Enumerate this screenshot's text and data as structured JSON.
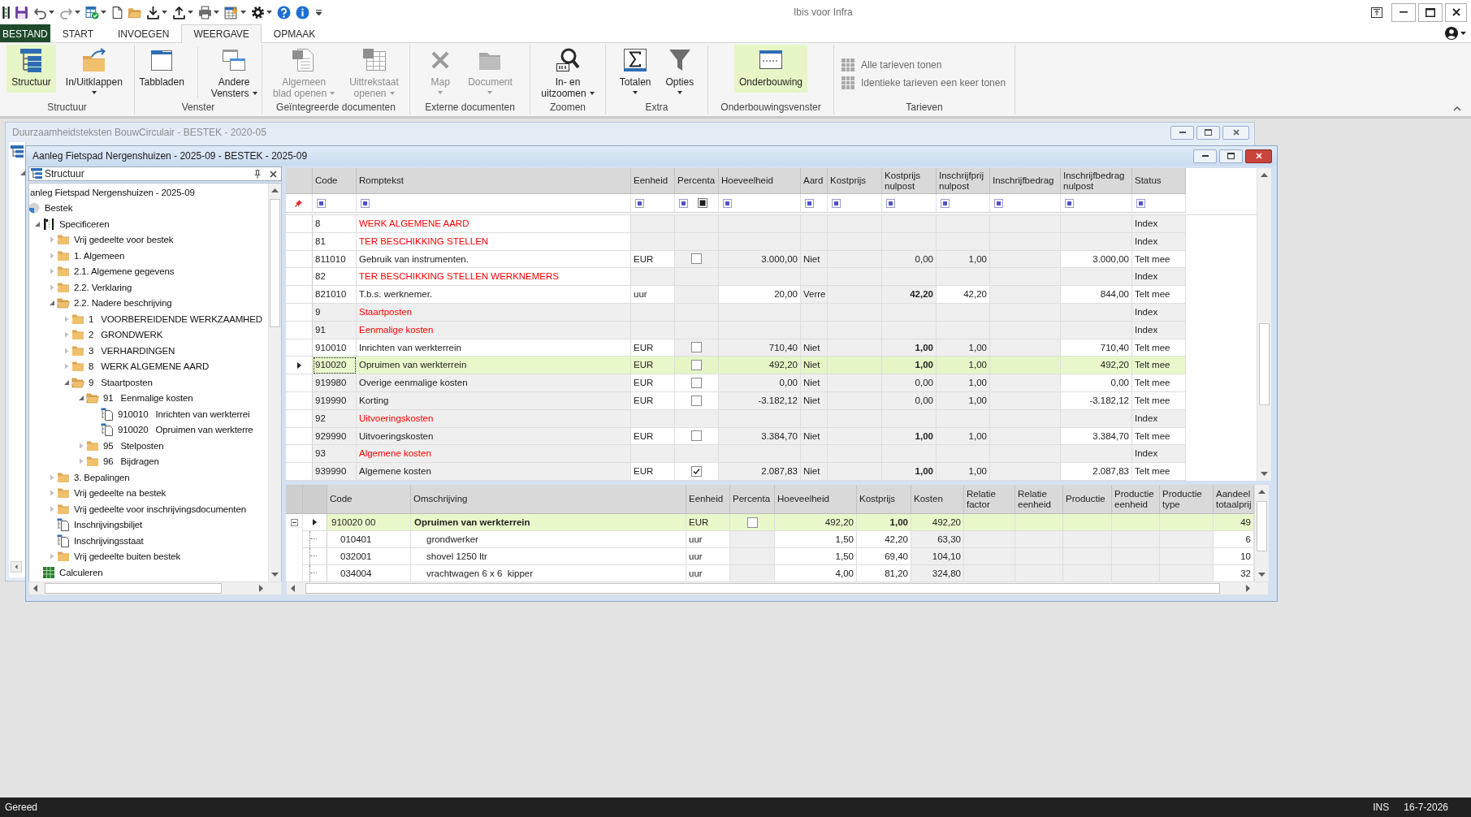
{
  "app": {
    "title": "Ibis voor Infra"
  },
  "ribbon": {
    "tabs": [
      {
        "label": "BESTAND",
        "kind": "file",
        "selected": false
      },
      {
        "label": "START",
        "kind": "tab",
        "selected": false
      },
      {
        "label": "INVOEGEN",
        "kind": "tab",
        "selected": false
      },
      {
        "label": "WEERGAVE",
        "kind": "tab",
        "selected": true
      },
      {
        "label": "OPMAAK",
        "kind": "tab",
        "selected": false
      }
    ],
    "groups": [
      {
        "label": "Structuur",
        "kind": "large",
        "buttons": [
          {
            "lines": [
              "Structuur"
            ],
            "dropdown": false,
            "selected": true,
            "disabled": false
          },
          {
            "lines": [
              "In/Uitklappen"
            ],
            "dropdown": true,
            "selected": false,
            "disabled": false
          }
        ]
      },
      {
        "label": "Venster",
        "kind": "large",
        "buttons": [
          {
            "lines": [
              "Tabbladen"
            ],
            "dropdown": false,
            "selected": false,
            "disabled": false
          },
          {
            "lines": [
              "Andere",
              "Vensters"
            ],
            "dropdown": true,
            "selected": false,
            "disabled": false,
            "divider": true
          }
        ]
      },
      {
        "label": "Geïntegreerde documenten",
        "kind": "large",
        "buttons": [
          {
            "lines": [
              "Algemeen",
              "blad openen"
            ],
            "dropdown": true,
            "selected": false,
            "disabled": true
          },
          {
            "lines": [
              "Uittrekstaat",
              "openen"
            ],
            "dropdown": true,
            "selected": false,
            "disabled": true
          }
        ]
      },
      {
        "label": "Externe documenten",
        "kind": "large",
        "buttons": [
          {
            "lines": [
              "Map"
            ],
            "dropdown": true,
            "selected": false,
            "disabled": true
          },
          {
            "lines": [
              "Document"
            ],
            "dropdown": true,
            "selected": false,
            "disabled": true
          }
        ]
      },
      {
        "label": "Zoomen",
        "kind": "large",
        "buttons": [
          {
            "lines": [
              "In- en",
              "uitzoomen"
            ],
            "dropdown": true,
            "selected": false,
            "disabled": false
          }
        ]
      },
      {
        "label": "Extra",
        "kind": "large",
        "buttons": [
          {
            "lines": [
              "Totalen"
            ],
            "dropdown": true,
            "selected": false,
            "disabled": false
          },
          {
            "lines": [
              "Opties"
            ],
            "dropdown": true,
            "selected": false,
            "disabled": false
          }
        ]
      },
      {
        "label": "Onderbouwingsvenster",
        "kind": "large",
        "buttons": [
          {
            "lines": [
              "Onderbouwing"
            ],
            "dropdown": false,
            "selected": true,
            "disabled": false
          }
        ]
      },
      {
        "label": "Tarieven",
        "kind": "small",
        "buttons": [
          {
            "lines": [
              "Alle tarieven tonen"
            ],
            "dropdown": false,
            "selected": false,
            "disabled": true
          },
          {
            "lines": [
              "Identieke tarieven een keer tonen"
            ],
            "dropdown": false,
            "selected": false,
            "disabled": true
          }
        ]
      }
    ]
  },
  "background_window": {
    "title": "Duurzaamheidsteksten BouwCirculair - BESTEK - 2020-05",
    "active": false,
    "structure_panel": {
      "tree": [
        {
          "expanded": true
        }
      ]
    }
  },
  "document_window": {
    "title": "Aanleg Fietspad Nergenshuizen - 2025-09 - BESTEK - 2025-09",
    "active": true,
    "structure_panel": {
      "title": "Structuur",
      "tree": [
        {
          "label": "anleg Fietspad Nergenshuizen - 2025-09",
          "children": [
            {
              "label": "Bestek",
              "kind": "section",
              "children": [
                {
                  "label": "Specificeren",
                  "kind": "phase",
                  "expanded": true,
                  "children": [
                    {
                      "label": "Vrij gedeelte voor bestek",
                      "kind": "folder",
                      "expanded": false
                    },
                    {
                      "label": "1. Algemeen",
                      "kind": "folder",
                      "expanded": false
                    },
                    {
                      "label": "2.1. Algemene gegevens",
                      "kind": "folder",
                      "expanded": false
                    },
                    {
                      "label": "2.2. Verklaring",
                      "kind": "folder",
                      "expanded": false
                    },
                    {
                      "label": "2.2. Nadere beschrijving",
                      "kind": "folder",
                      "expanded": true,
                      "children": [
                        {
                          "code": "1",
                          "label": "VOORBEREIDENDE WERKZAAMHED",
                          "kind": "folder",
                          "expanded": false
                        },
                        {
                          "code": "2",
                          "label": "GRONDWERK",
                          "kind": "folder",
                          "expanded": false
                        },
                        {
                          "code": "3",
                          "label": "VERHARDINGEN",
                          "kind": "folder",
                          "expanded": false
                        },
                        {
                          "code": "8",
                          "label": "WERK ALGEMENE AARD",
                          "kind": "folder",
                          "expanded": false
                        },
                        {
                          "code": "9",
                          "label": "Staartposten",
                          "kind": "folder",
                          "expanded": true,
                          "children": [
                            {
                              "code": "91",
                              "label": "Eenmalige kosten",
                              "kind": "folder",
                              "expanded": true,
                              "children": [
                                {
                                  "code": "910010",
                                  "label": "Inrichten van werkterrei",
                                  "kind": "entry"
                                },
                                {
                                  "code": "910020",
                                  "label": "Opruimen van werkterre",
                                  "kind": "entry"
                                }
                              ]
                            },
                            {
                              "code": "95",
                              "label": "Stelposten",
                              "kind": "folder",
                              "expanded": false
                            },
                            {
                              "code": "96",
                              "label": "Bijdragen",
                              "kind": "folder",
                              "expanded": false
                            }
                          ]
                        }
                      ]
                    },
                    {
                      "label": "3. Bepalingen",
                      "kind": "folder",
                      "expanded": false
                    },
                    {
                      "label": "Vrij gedeelte na bestek",
                      "kind": "folder",
                      "expanded": false
                    },
                    {
                      "label": "Vrij gedeelte voor inschrijvingsdocumenten",
                      "kind": "folder",
                      "expanded": false
                    },
                    {
                      "label": "Inschrijvingsbiljet",
                      "kind": "document"
                    },
                    {
                      "label": "Inschrijvingsstaat",
                      "kind": "document"
                    },
                    {
                      "label": "Vrij gedeelte buiten bestek",
                      "kind": "folder",
                      "expanded": false
                    }
                  ]
                },
                {
                  "label": "Calculeren",
                  "kind": "calculation"
                }
              ]
            }
          ]
        }
      ]
    },
    "main_grid": {
      "columns": [
        {
          "label": "Code",
          "kind": "text"
        },
        {
          "label": "Romptekst",
          "kind": "text"
        },
        {
          "label": "Eenheid",
          "kind": "text"
        },
        {
          "label": "Percenta",
          "kind": "check",
          "filter_indeterminate": true
        },
        {
          "label": "Hoeveelheid",
          "kind": "text"
        },
        {
          "label": "Aard",
          "kind": "text"
        },
        {
          "label": "Kostprijs",
          "kind": "text"
        },
        {
          "label": "Kostprijs nulpost",
          "kind": "text"
        },
        {
          "label": "Inschrijfprij nulpost",
          "kind": "text"
        },
        {
          "label": "Inschrijfbedrag",
          "kind": "text"
        },
        {
          "label": "Inschrijfbedrag nulpost",
          "kind": "text"
        },
        {
          "label": "Status",
          "kind": "text"
        }
      ],
      "rows": [
        {
          "kind": "heading",
          "selected": false,
          "shaded": false,
          "code": "8",
          "romptekst": "WERK ALGEMENE AARD",
          "status": "Index"
        },
        {
          "kind": "heading",
          "selected": false,
          "shaded": false,
          "code": "81",
          "romptekst": "TER BESCHIKKING STELLEN",
          "status": "Index"
        },
        {
          "kind": "item",
          "selected": false,
          "shaded": false,
          "editable": false,
          "emphasized": false,
          "code": "811010",
          "romptekst": "Gebruik van instrumenten.",
          "eenheid": "EUR",
          "percenta": false,
          "hoeveelheid": "3.000,00",
          "aard": "Niet",
          "kostprijs_nulpost": "0,00",
          "inschrijfprij_nulpost": "1,00",
          "inschrijfbedrag_nulpost": "3.000,00",
          "status": "Telt mee"
        },
        {
          "kind": "heading",
          "selected": false,
          "shaded": false,
          "code": "82",
          "romptekst": "TER BESCHIKKING STELLEN WERKNEMERS",
          "status": "Index"
        },
        {
          "kind": "item",
          "selected": false,
          "shaded": false,
          "editable": true,
          "emphasized": true,
          "code": "821010",
          "romptekst": "T.b.s. werknemer.",
          "eenheid": "uur",
          "hoeveelheid": "20,00",
          "aard": "Verre",
          "kostprijs_nulpost": "42,20",
          "inschrijfprij_nulpost": "42,20",
          "inschrijfbedrag_nulpost": "844,00",
          "status": "Telt mee"
        },
        {
          "kind": "heading",
          "selected": false,
          "shaded": true,
          "code": "9",
          "romptekst": "Staartposten",
          "status": "Index"
        },
        {
          "kind": "heading",
          "selected": false,
          "shaded": true,
          "code": "91",
          "romptekst": "Eenmalige kosten",
          "status": "Index"
        },
        {
          "kind": "item",
          "selected": false,
          "shaded": false,
          "editable": false,
          "emphasized": true,
          "code": "910010",
          "romptekst": "Inrichten van werkterrein",
          "eenheid": "EUR",
          "percenta": false,
          "hoeveelheid": "710,40",
          "aard": "Niet",
          "kostprijs_nulpost": "1,00",
          "inschrijfprij_nulpost": "1,00",
          "inschrijfbedrag_nulpost": "710,40",
          "status": "Telt mee"
        },
        {
          "kind": "item",
          "selected": true,
          "shaded": false,
          "editable": false,
          "emphasized": true,
          "code": "910020",
          "romptekst": "Opruimen van werkterrein",
          "eenheid": "EUR",
          "percenta": false,
          "hoeveelheid": "492,20",
          "aard": "Niet",
          "kostprijs_nulpost": "1,00",
          "inschrijfprij_nulpost": "1,00",
          "inschrijfbedrag_nulpost": "492,20",
          "status": "Telt mee"
        },
        {
          "kind": "item",
          "selected": false,
          "shaded": true,
          "editable": false,
          "emphasized": false,
          "code": "919980",
          "romptekst": "Overige eenmalige kosten",
          "eenheid": "EUR",
          "percenta": false,
          "hoeveelheid": "0,00",
          "aard": "Niet",
          "kostprijs_nulpost": "0,00",
          "inschrijfprij_nulpost": "1,00",
          "inschrijfbedrag_nulpost": "0,00",
          "status": "Telt mee"
        },
        {
          "kind": "item",
          "selected": false,
          "shaded": true,
          "editable": false,
          "emphasized": false,
          "code": "919990",
          "romptekst": "Korting",
          "eenheid": "EUR",
          "percenta": false,
          "hoeveelheid": "-3.182,12",
          "aard": "Niet",
          "kostprijs_nulpost": "0,00",
          "inschrijfprij_nulpost": "1,00",
          "inschrijfbedrag_nulpost": "-3.182,12",
          "status": "Telt mee"
        },
        {
          "kind": "heading",
          "selected": false,
          "shaded": true,
          "code": "92",
          "romptekst": "Uitvoeringskosten",
          "status": "Index"
        },
        {
          "kind": "item",
          "selected": false,
          "shaded": true,
          "editable": false,
          "emphasized": true,
          "code": "929990",
          "romptekst": "Uitvoeringskosten",
          "eenheid": "EUR",
          "percenta": false,
          "hoeveelheid": "3.384,70",
          "aard": "Niet",
          "kostprijs_nulpost": "1,00",
          "inschrijfprij_nulpost": "1,00",
          "inschrijfbedrag_nulpost": "3.384,70",
          "status": "Telt mee"
        },
        {
          "kind": "heading",
          "selected": false,
          "shaded": true,
          "code": "93",
          "romptekst": "Algemene kosten",
          "status": "Index"
        },
        {
          "kind": "item",
          "selected": false,
          "shaded": true,
          "editable": false,
          "emphasized": true,
          "code": "939990",
          "romptekst": "Algemene kosten",
          "eenheid": "EUR",
          "percenta": true,
          "hoeveelheid": "2.087,83",
          "aard": "Niet",
          "kostprijs_nulpost": "1,00",
          "inschrijfprij_nulpost": "1,00",
          "inschrijfbedrag_nulpost": "2.087,83",
          "status": "Telt mee"
        }
      ]
    },
    "detail_grid": {
      "columns": [
        {
          "label": "Code",
          "kind": "text"
        },
        {
          "label": "Omschrijving",
          "kind": "text"
        },
        {
          "label": "Eenheid",
          "kind": "text"
        },
        {
          "label": "Percenta",
          "kind": "check"
        },
        {
          "label": "Hoeveelheid",
          "kind": "text"
        },
        {
          "label": "Kostprijs",
          "kind": "text"
        },
        {
          "label": "Kosten",
          "kind": "text"
        },
        {
          "label": "Relatie factor",
          "kind": "text"
        },
        {
          "label": "Relatie eenheid",
          "kind": "text"
        },
        {
          "label": "Productie",
          "kind": "text"
        },
        {
          "label": "Productie eenheid",
          "kind": "text"
        },
        {
          "label": "Productie type",
          "kind": "text"
        },
        {
          "label": "Aandeel totaalprij",
          "kind": "text"
        }
      ],
      "rows": [
        {
          "code": "910020 00",
          "omschrijving": "Opruimen van werkterrein",
          "eenheid": "EUR",
          "percenta": false,
          "hoeveelheid": "492,20",
          "kostprijs": "1,00",
          "kosten": "492,20",
          "aandeel_totaalprij": "49",
          "selected": true,
          "emphasized": true,
          "expanded": true,
          "children": [
            {
              "code": "010401",
              "omschrijving": "grondwerker",
              "eenheid": "uur",
              "hoeveelheid": "1,50",
              "kostprijs": "42,20",
              "kosten": "63,30",
              "aandeel_totaalprij": "6",
              "selected": false,
              "emphasized": false
            },
            {
              "code": "032001",
              "omschrijving": "shovel 1250 ltr",
              "eenheid": "uur",
              "hoeveelheid": "1,50",
              "kostprijs": "69,40",
              "kosten": "104,10",
              "aandeel_totaalprij": "10",
              "selected": false,
              "emphasized": false
            },
            {
              "code": "034004",
              "omschrijving": "vrachtwagen 6 x 6  kipper",
              "eenheid": "uur",
              "hoeveelheid": "4,00",
              "kostprijs": "81,20",
              "kosten": "324,80",
              "aandeel_totaalprij": "32",
              "selected": false,
              "emphasized": false
            }
          ]
        }
      ]
    }
  },
  "status_bar": {
    "message": "Gereed",
    "mode": "INS",
    "date": "16-7-2026"
  }
}
